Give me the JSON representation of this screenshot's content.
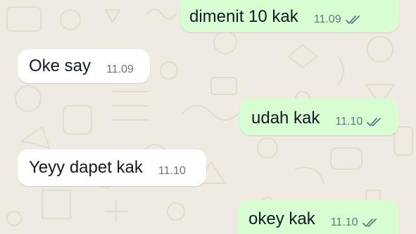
{
  "conversation": {
    "messages": [
      {
        "direction": "outgoing",
        "text": "dimenit 10 kak",
        "time": "11.09",
        "status_icon": "double-check-icon"
      },
      {
        "direction": "incoming",
        "text": "Oke say",
        "time": "11.09"
      },
      {
        "direction": "outgoing",
        "text": "udah kak",
        "time": "11.10",
        "status_icon": "double-check-icon"
      },
      {
        "direction": "incoming",
        "text": "Yeyy dapet kak",
        "time": "11.10"
      },
      {
        "direction": "outgoing",
        "text": "okey kak",
        "time": "11.10",
        "status_icon": "double-check-icon"
      }
    ]
  },
  "colors": {
    "wallpaper": "#efeae2",
    "outgoing_bubble": "#d9fdd3",
    "incoming_bubble": "#ffffff",
    "text": "#111b21",
    "meta": "#667781"
  }
}
